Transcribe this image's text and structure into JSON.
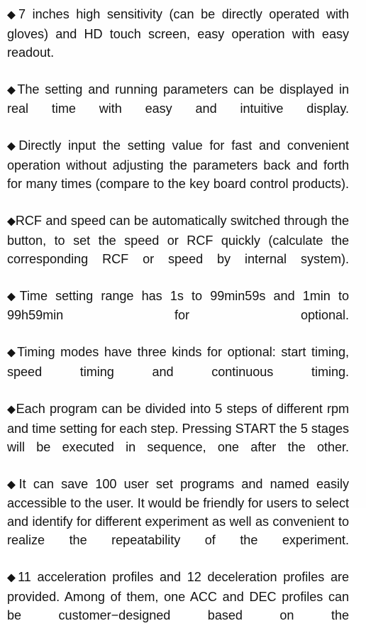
{
  "document": {
    "type": "product-specification-text",
    "background_color": "#fefefe",
    "text_color": "#141414",
    "bullet_glyph": "◆",
    "bullet_icon_name": "black-diamond-bullet-icon",
    "alignment": "justify",
    "features": [
      {
        "id": "display-touch-screen",
        "text": "7 inches high sensitivity (can be directly operated with gloves) and HD touch screen, easy operation with easy readout."
      },
      {
        "id": "realtime-parameters",
        "text": "The setting and running parameters can be displayed in real time with easy and intuitive display."
      },
      {
        "id": "direct-input",
        "text": "Directly input the setting value for fast and convenient operation without adjusting the parameters back and forth for many times (compare to the key board control products)."
      },
      {
        "id": "rcf-speed-switch",
        "text": "RCF and speed can be automatically switched through the button, to set the speed or RCF quickly (calculate the corresponding RCF or speed by internal system)."
      },
      {
        "id": "time-setting-range",
        "text": "Time setting range has 1s to 99min59s and 1min to 99h59min for optional."
      },
      {
        "id": "timing-modes",
        "text": "Timing modes have three kinds for optional: start timing, speed timing and continuous timing."
      },
      {
        "id": "program-steps",
        "text": "Each program can be divided into 5 steps of different rpm and time setting for each step. Pressing START the 5 stages will be executed in sequence, one after the other."
      },
      {
        "id": "saved-programs",
        "text": "It can save 100 user set programs and named easily accessible to the user. It would be friendly for users to select and identify for different experiment as well as convenient to realize the repeatability of the experiment."
      },
      {
        "id": "acc-dec-profiles",
        "text": "11 acceleration profiles and 12 deceleration profiles are provided. Among of them, one ACC and DEC profiles can be customer−designed based on the"
      }
    ]
  }
}
